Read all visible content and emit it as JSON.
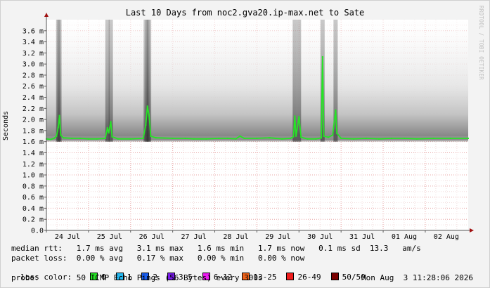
{
  "title": "Last 10 Days from noc2.gva20.ip-max.net to Sate",
  "side_credit": "RRDTOOL / TOBI OETIKER",
  "stats": {
    "median_rtt": "median rtt:   1.7 ms avg   3.1 ms max   1.6 ms min   1.7 ms now   0.1 ms sd  13.3   am/s",
    "packet_loss": "packet loss:  0.00 % avg   0.17 % max   0.00 % min   0.00 % now",
    "loss_color_label": "loss color:",
    "probe": "probe:        50 ICMP Echo Pings (56 Bytes) every 300s",
    "timestamp": "Mon Aug  3 11:28:06 2026"
  },
  "loss_colors": [
    {
      "label": "0",
      "color": "#26e426"
    },
    {
      "label": "1",
      "color": "#24b7ef"
    },
    {
      "label": "2",
      "color": "#1a5fef"
    },
    {
      "label": "3-5",
      "color": "#7a1ced"
    },
    {
      "label": "6-12",
      "color": "#ec1af0"
    },
    {
      "label": "13-25",
      "color": "#ef631b"
    },
    {
      "label": "26-49",
      "color": "#ef1c1c"
    },
    {
      "label": "50/50",
      "color": "#7a0000"
    }
  ],
  "chart_data": {
    "type": "line",
    "ylabel": "Seconds",
    "ylim": [
      0,
      3.8
    ],
    "y_ticks": [
      "0.0",
      "0.2 m",
      "0.4 m",
      "0.6 m",
      "0.8 m",
      "1.0 m",
      "1.2 m",
      "1.4 m",
      "1.6 m",
      "1.8 m",
      "2.0 m",
      "2.2 m",
      "2.4 m",
      "2.6 m",
      "2.8 m",
      "3.0 m",
      "3.2 m",
      "3.4 m",
      "3.6 m"
    ],
    "x_ticks": [
      "24 Jul",
      "25 Jul",
      "26 Jul",
      "27 Jul",
      "28 Jul",
      "29 Jul",
      "30 Jul",
      "31 Jul",
      "01 Aug",
      "02 Aug"
    ],
    "x_range_days": [
      0,
      10.02
    ],
    "series": [
      {
        "color": "#26e426",
        "points": [
          [
            0,
            1.65
          ],
          [
            0.1,
            1.64
          ],
          [
            0.18,
            1.66
          ],
          [
            0.24,
            1.7
          ],
          [
            0.28,
            1.86
          ],
          [
            0.31,
            2.07
          ],
          [
            0.34,
            1.72
          ],
          [
            0.4,
            1.67
          ],
          [
            0.6,
            1.66
          ],
          [
            0.8,
            1.66
          ],
          [
            1.0,
            1.65
          ],
          [
            1.2,
            1.65
          ],
          [
            1.4,
            1.66
          ],
          [
            1.45,
            1.85
          ],
          [
            1.48,
            1.76
          ],
          [
            1.53,
            1.96
          ],
          [
            1.56,
            1.69
          ],
          [
            1.7,
            1.65
          ],
          [
            2.0,
            1.65
          ],
          [
            2.3,
            1.66
          ],
          [
            2.36,
            1.9
          ],
          [
            2.4,
            2.24
          ],
          [
            2.44,
            2.07
          ],
          [
            2.48,
            1.7
          ],
          [
            2.6,
            1.67
          ],
          [
            3.0,
            1.66
          ],
          [
            3.3,
            1.66
          ],
          [
            3.5,
            1.65
          ],
          [
            3.8,
            1.65
          ],
          [
            4.1,
            1.66
          ],
          [
            4.3,
            1.66
          ],
          [
            4.5,
            1.65
          ],
          [
            4.6,
            1.7
          ],
          [
            4.7,
            1.66
          ],
          [
            5.0,
            1.66
          ],
          [
            5.3,
            1.67
          ],
          [
            5.6,
            1.65
          ],
          [
            5.8,
            1.66
          ],
          [
            5.87,
            1.69
          ],
          [
            5.9,
            2.06
          ],
          [
            5.93,
            1.7
          ],
          [
            6.0,
            2.05
          ],
          [
            6.05,
            1.68
          ],
          [
            6.2,
            1.65
          ],
          [
            6.4,
            1.65
          ],
          [
            6.53,
            1.67
          ],
          [
            6.56,
            3.13
          ],
          [
            6.59,
            1.7
          ],
          [
            6.7,
            1.68
          ],
          [
            6.8,
            1.72
          ],
          [
            6.87,
            2.17
          ],
          [
            6.9,
            1.75
          ],
          [
            7.0,
            1.66
          ],
          [
            7.3,
            1.65
          ],
          [
            7.6,
            1.66
          ],
          [
            7.9,
            1.65
          ],
          [
            8.2,
            1.66
          ],
          [
            8.5,
            1.66
          ],
          [
            8.8,
            1.65
          ],
          [
            9.2,
            1.66
          ],
          [
            9.6,
            1.66
          ],
          [
            10.02,
            1.66
          ]
        ]
      }
    ],
    "grid": true
  }
}
